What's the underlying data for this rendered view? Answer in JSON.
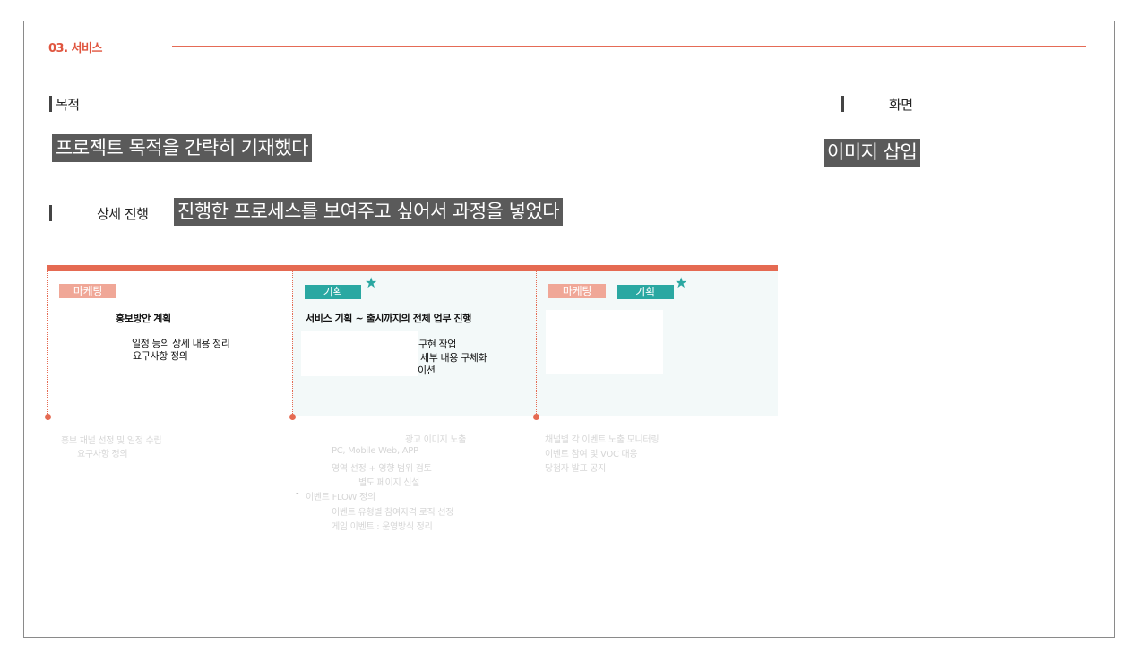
{
  "header": {
    "section": "03. 서비스"
  },
  "purpose": {
    "label": "목적",
    "note": "프로젝트 목적을 간략히 기재했다"
  },
  "screen": {
    "label": "화면",
    "note": "이미지 삽입"
  },
  "detail": {
    "label": "상세 진행",
    "note": "진행한 프로세스를 보여주고 싶어서 과정을 넣었다"
  },
  "process": {
    "columns": [
      {
        "tags": [
          "마케팅"
        ],
        "starred": false,
        "title": "홍보방안 계획",
        "lines": [
          "일정 등의 상세 내용 정리",
          "요구사항 정의"
        ],
        "faded": [
          "홍보 채널 선정 및 일정 수립",
          "요구사항 정의"
        ]
      },
      {
        "tags": [
          "기획"
        ],
        "starred": true,
        "title": "서비스 기획 ~ 출시까지의 전체 업무 진행",
        "lines": [
          "구현 작업",
          "세부 내용 구체화",
          "이션"
        ],
        "faded": [
          "광고 이미지 노출",
          "PC, Mobile Web, APP",
          "영역 선정 + 영향 범위 검토",
          "별도 페이지 신설",
          "이벤트 FLOW 정의",
          "이벤트 유형별 참여자격 로직 선정",
          "게임 이벤트 : 운영방식 정리"
        ]
      },
      {
        "tags": [
          "마케팅",
          "기획"
        ],
        "starred": true,
        "title": "",
        "lines": [],
        "faded": [
          "채널별 각 이벤트 노출 모니터링",
          "이벤트 참여 및 VOC 대응",
          "당첨자 발표 공지"
        ]
      }
    ]
  },
  "colors": {
    "accent": "#e56a52",
    "teal": "#2aa8a2",
    "pink": "#f0a797",
    "note_bg": "#5a5a5a"
  },
  "icons": {
    "star": "★"
  }
}
